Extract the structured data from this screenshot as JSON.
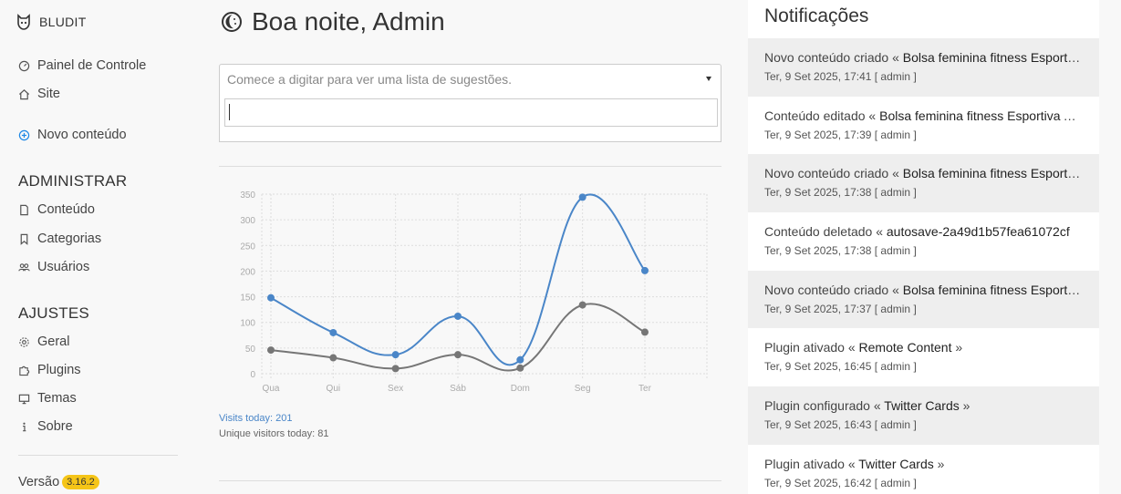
{
  "brand": {
    "name": "BLUDIT",
    "logo_icon": "bludit-logo-icon"
  },
  "sidebar": {
    "top_items": [
      {
        "label": "Painel de Controle",
        "icon": "dashboard-icon"
      },
      {
        "label": "Site",
        "icon": "home-icon"
      }
    ],
    "new_content": {
      "label": "Novo conteúdo",
      "icon": "plus-circle-icon"
    },
    "admin_title": "ADMINISTRAR",
    "admin_items": [
      {
        "label": "Conteúdo",
        "icon": "file-icon"
      },
      {
        "label": "Categorias",
        "icon": "bookmark-icon"
      },
      {
        "label": "Usuários",
        "icon": "users-icon"
      }
    ],
    "settings_title": "AJUSTES",
    "settings_items": [
      {
        "label": "Geral",
        "icon": "gear-icon"
      },
      {
        "label": "Plugins",
        "icon": "puzzle-icon"
      },
      {
        "label": "Temas",
        "icon": "monitor-icon"
      },
      {
        "label": "Sobre",
        "icon": "info-icon"
      }
    ],
    "version_label": "Versão",
    "version_number": "3.16.2"
  },
  "main": {
    "greeting": "Boa noite, Admin",
    "greeting_icon": "moon-icon",
    "search": {
      "placeholder": "Comece a digitar para ver uma lista de sugestões.",
      "input_value": ""
    },
    "visits_today": "Visits today: 201",
    "unique_visitors_today": "Unique visitors today: 81"
  },
  "chart_data": {
    "type": "line",
    "categories": [
      "Qua",
      "Qui",
      "Sex",
      "Sáb",
      "Dom",
      "Seg",
      "Ter"
    ],
    "series": [
      {
        "values": [
          148,
          80,
          37,
          112,
          27,
          344,
          201
        ],
        "color": "#4a86c8"
      },
      {
        "values": [
          46,
          31,
          10,
          37,
          11,
          134,
          81
        ],
        "color": "#767676"
      }
    ],
    "yticks": [
      0,
      50,
      100,
      150,
      200,
      250,
      300,
      350
    ],
    "ylim": [
      0,
      350
    ],
    "grid": true
  },
  "notifications": {
    "title": "Notificações",
    "items": [
      {
        "text": "Novo conteúdo criado « ",
        "object": "Bolsa feminina fitness Esportiva Academia Treino Grande",
        "meta": "Ter, 9 Set 2025, 17:41 [ admin ]"
      },
      {
        "text": "Conteúdo editado « ",
        "object": "Bolsa feminina fitness Esportiva Academia Treino Grande",
        "meta": "Ter, 9 Set 2025, 17:39 [ admin ]"
      },
      {
        "text": "Novo conteúdo criado « ",
        "object": "Bolsa feminina fitness Esportiva Academia Treino Grande",
        "meta": "Ter, 9 Set 2025, 17:38 [ admin ]"
      },
      {
        "text": "Conteúdo deletado « ",
        "object": "autosave-2a49d1b57fea61072cf",
        "meta": "Ter, 9 Set 2025, 17:38 [ admin ]"
      },
      {
        "text": "Novo conteúdo criado « ",
        "object": "Bolsa feminina fitness Esportiva Academia Treino Grande",
        "meta": "Ter, 9 Set 2025, 17:37 [ admin ]"
      },
      {
        "text": "Plugin ativado « ",
        "object": "Remote Content",
        "suffix": " »",
        "meta": "Ter, 9 Set 2025, 16:45 [ admin ]"
      },
      {
        "text": "Plugin configurado « ",
        "object": "Twitter Cards",
        "suffix": " »",
        "meta": "Ter, 9 Set 2025, 16:43 [ admin ]"
      },
      {
        "text": "Plugin ativado « ",
        "object": "Twitter Cards",
        "suffix": " »",
        "meta": "Ter, 9 Set 2025, 16:42 [ admin ]"
      }
    ]
  }
}
